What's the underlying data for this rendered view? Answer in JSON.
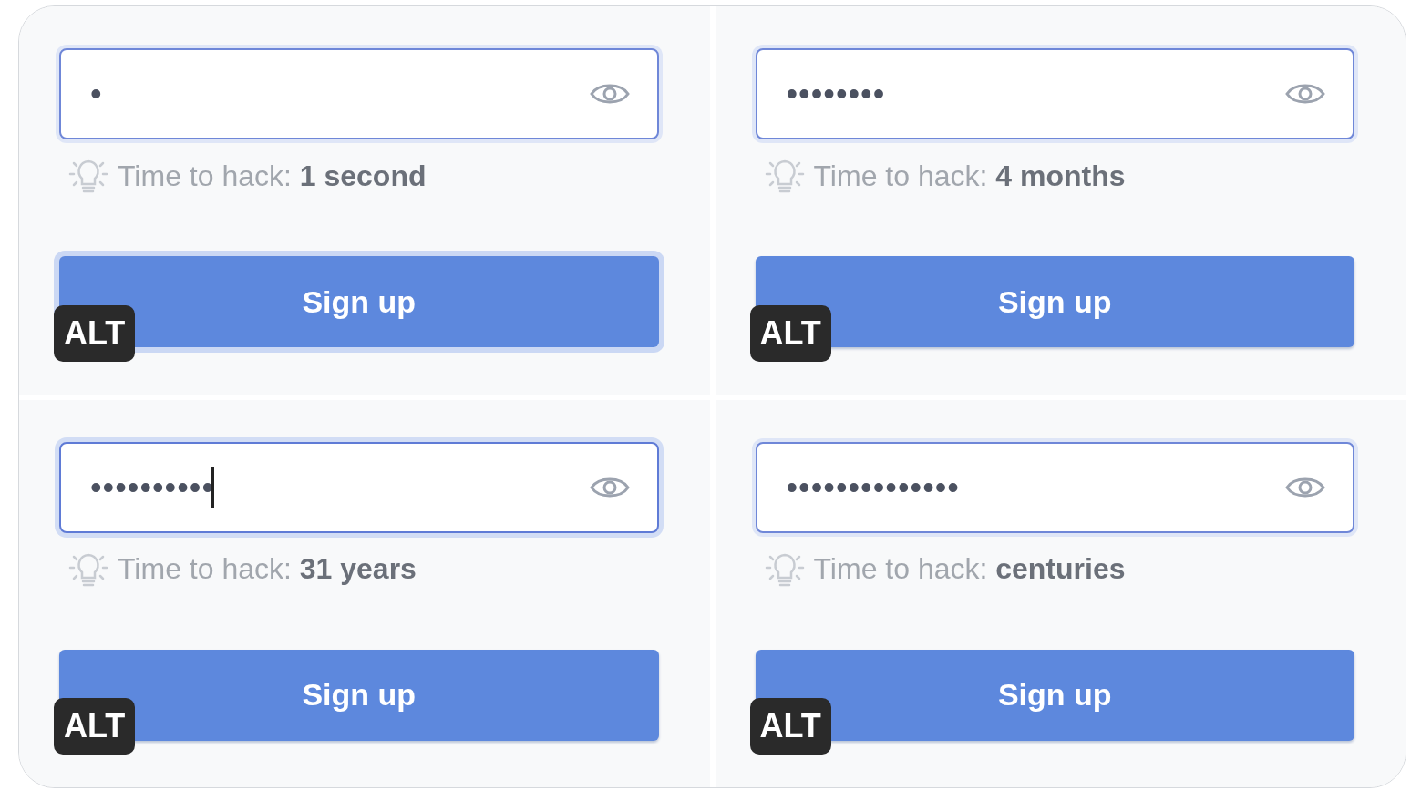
{
  "panels": [
    {
      "password": {
        "value": "•",
        "focused": false
      },
      "hint": "Time to hack: **1 second**",
      "button": {
        "label": "Sign up",
        "focused": true
      },
      "badge": "ALT"
    },
    {
      "password": {
        "value": "••••••••",
        "focused": false
      },
      "hint": "Time to hack: **4 months**",
      "button": {
        "label": "Sign up",
        "focused": false
      },
      "badge": "ALT"
    },
    {
      "password": {
        "value": "••••••••••",
        "focused": true
      },
      "hint": "Time to hack: **31 years**",
      "button": {
        "label": "Sign up",
        "focused": false
      },
      "badge": "ALT"
    },
    {
      "password": {
        "value": "••••••••••••••",
        "focused": false
      },
      "hint": "Time to hack: **centuries**",
      "button": {
        "label": "Sign up",
        "focused": false
      },
      "badge": "ALT"
    }
  ]
}
